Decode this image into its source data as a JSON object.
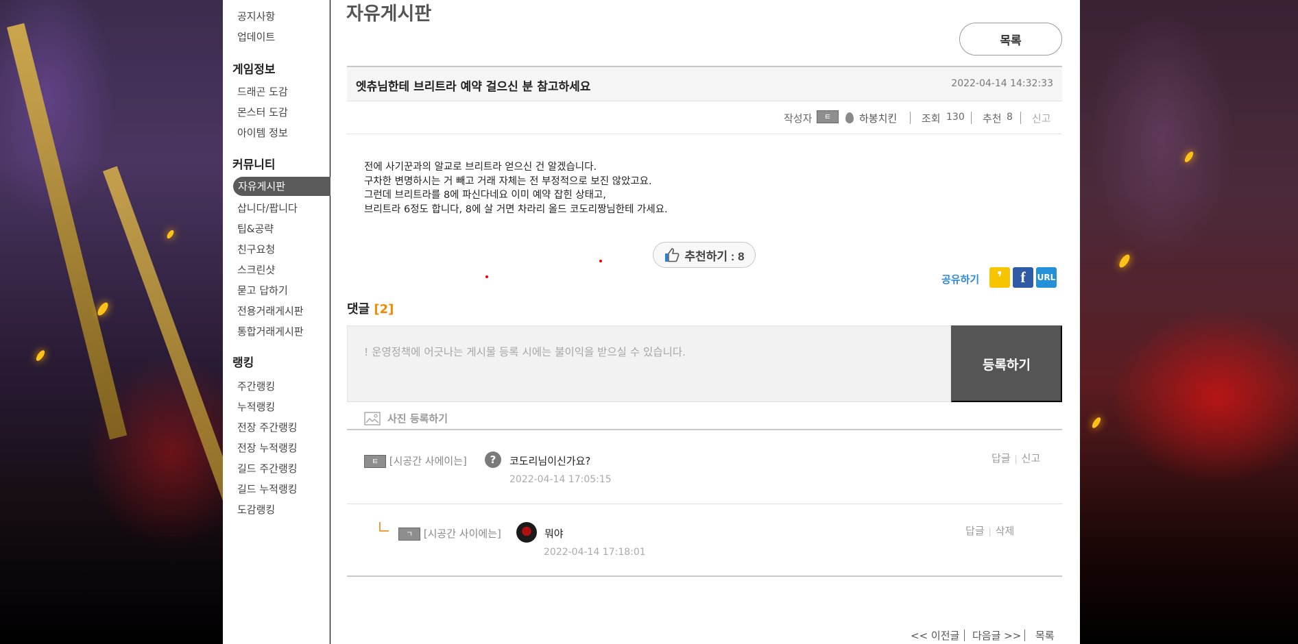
{
  "sidebar": {
    "top_items": [
      {
        "label": "공지사항"
      },
      {
        "label": "업데이트"
      }
    ],
    "groups": [
      {
        "title": "게임정보",
        "items": [
          {
            "label": "드래곤 도감"
          },
          {
            "label": "몬스터 도감"
          },
          {
            "label": "아이템 정보"
          }
        ]
      },
      {
        "title": "커뮤니티",
        "items": [
          {
            "label": "자유게시판",
            "active": true
          },
          {
            "label": "삽니다/팝니다"
          },
          {
            "label": "팁&공략"
          },
          {
            "label": "친구요청"
          },
          {
            "label": "스크린샷"
          },
          {
            "label": "묻고 답하기"
          },
          {
            "label": "전용거래게시판"
          },
          {
            "label": "통합거래게시판"
          }
        ]
      },
      {
        "title": "랭킹",
        "items": [
          {
            "label": "주간랭킹"
          },
          {
            "label": "누적랭킹"
          },
          {
            "label": "전장 주간랭킹"
          },
          {
            "label": "전장 누적랭킹"
          },
          {
            "label": "길드 주간랭킹"
          },
          {
            "label": "길드 누적랭킹"
          },
          {
            "label": "도감랭킹"
          }
        ]
      }
    ]
  },
  "board": {
    "title": "자유게시판",
    "list_button": "목록"
  },
  "post": {
    "title": "엣츄님한테 브리트라 예약 걸으신 분 참고하세요",
    "date": "2022-04-14 14:32:33",
    "author_label": "작성자",
    "author_level": "ㅌ",
    "author_name": "하봉치킨",
    "views_label": "조회",
    "views": "130",
    "recommend_label": "추천",
    "recommend_count": "8",
    "report_label": "신고",
    "body_lines": [
      "전에 사기꾼과의 알교로 브리트라 얻으신 건 알겠습니다.",
      "구차한 변명하시는 거 빼고 거래 자체는 전 부정적으로 보진 않았고요.",
      "그런데 브리트라를 8에 파신다네요 이미 예약 잡힌 상태고,",
      "브리트라 6정도 합니다, 8에 살 거면 차라리 올드 코도리짱님한테 가세요."
    ],
    "recommend_button": "추천하기 : 8",
    "share_label": "공유하기",
    "share_icons": [
      "kakao-story-icon",
      "facebook-icon",
      "url-icon"
    ],
    "share_url_text": "URL",
    "share_facebook_text": "f",
    "share_kakao_text": "❜"
  },
  "comments": {
    "heading": "댓글",
    "count": "[2]",
    "input_placeholder": "! 운영정책에 어긋나는 게시물 등록 시에는 불이익을 받으실 수 있습니다.",
    "submit_label": "등록하기",
    "photo_label": "사진 등록하기",
    "items": [
      {
        "level": "ㅌ",
        "author": "[시공간 사에이는]",
        "text": "코도리님이신가요?",
        "date": "2022-04-14 17:05:15",
        "actions": [
          "답글",
          "신고"
        ]
      },
      {
        "level": "ㄱ",
        "author": "[시공간 사이에는]",
        "text": "뭐야",
        "date": "2022-04-14 17:18:01",
        "actions": [
          "답글",
          "삭제"
        ],
        "is_reply": true
      }
    ]
  },
  "pager": {
    "prev": "<< 이전글",
    "next": "다음글 >>",
    "list": "목록"
  }
}
